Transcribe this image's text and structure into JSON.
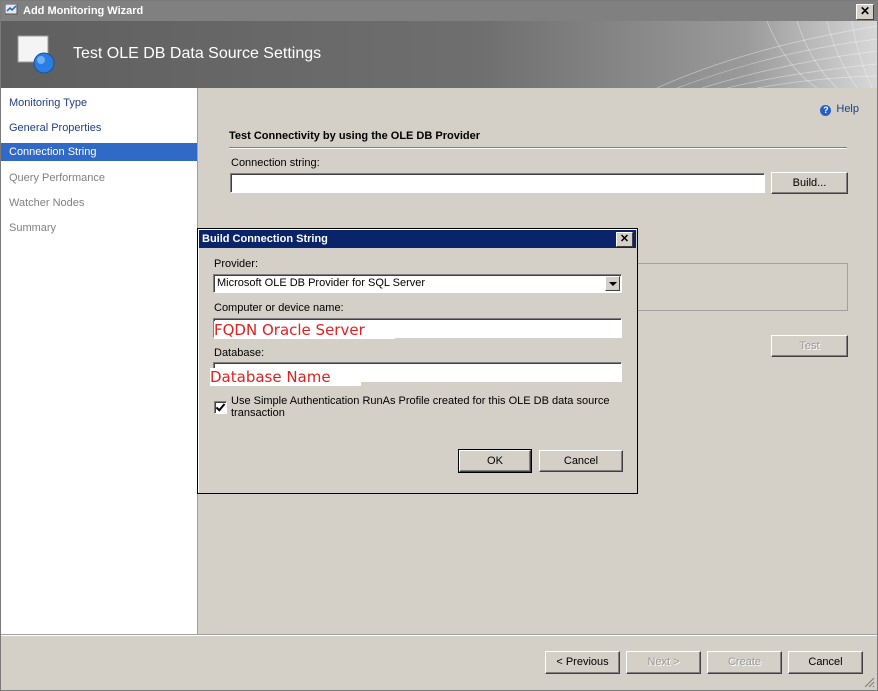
{
  "window": {
    "title": "Add Monitoring Wizard",
    "close_glyph": "✕"
  },
  "banner": {
    "title": "Test OLE DB Data Source Settings"
  },
  "nav": {
    "items": [
      {
        "label": "Monitoring Type"
      },
      {
        "label": "General Properties"
      },
      {
        "label": "Connection String"
      },
      {
        "label": "Query Performance"
      },
      {
        "label": "Watcher Nodes"
      },
      {
        "label": "Summary"
      }
    ]
  },
  "main": {
    "help_label": "Help",
    "section_title": "Test Connectivity by using the OLE DB Provider",
    "connection_string_label": "Connection string:",
    "connection_string_value": "",
    "build_button": "Build...",
    "test_button": "Test"
  },
  "dialog": {
    "title": "Build Connection String",
    "provider_label": "Provider:",
    "provider_value": "Microsoft OLE DB Provider for SQL Server",
    "computer_label": "Computer or device name:",
    "computer_value": "FQDN Oracle Server",
    "database_label": "Database:",
    "database_value": "Database Name",
    "checkbox_label_line1": "Use Simple Authentication RunAs Profile created for this OLE DB data source",
    "checkbox_label_line2": "transaction",
    "checkbox_checked": true,
    "ok_button": "OK",
    "cancel_button": "Cancel"
  },
  "footer": {
    "previous_button": "< Previous",
    "next_button": "Next >",
    "create_button": "Create",
    "cancel_button": "Cancel"
  },
  "colors": {
    "selected_nav": "#3169c6",
    "dialog_title": "#0a246a",
    "annotation_red": "#e02020"
  }
}
